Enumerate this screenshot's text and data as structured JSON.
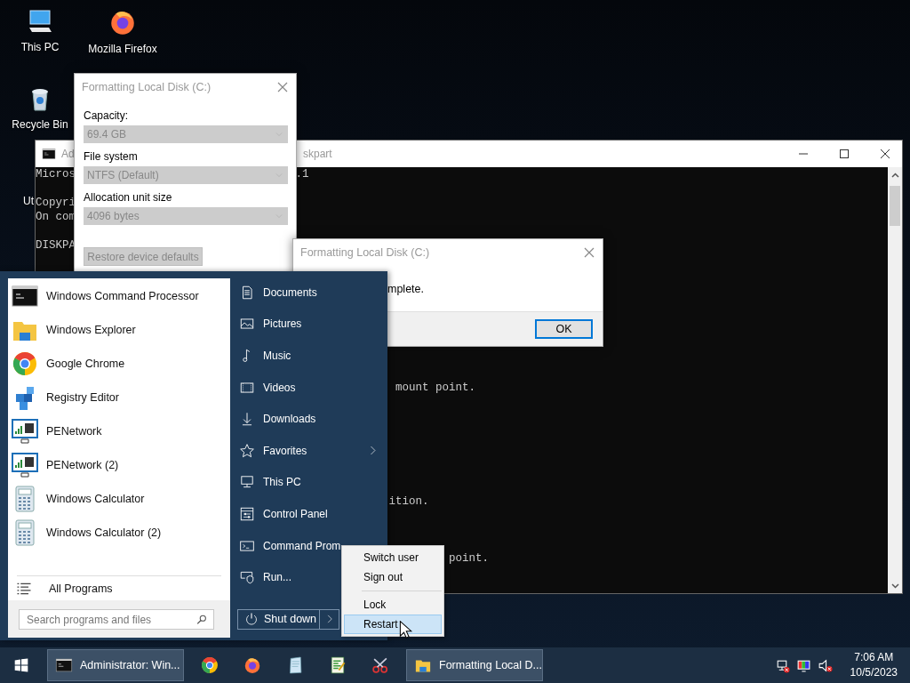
{
  "desktop_icons": [
    {
      "label": "This PC",
      "kind": "computer"
    },
    {
      "label": "Mozilla Firefox",
      "kind": "firefox"
    },
    {
      "label": "Recycle Bin",
      "kind": "recycle"
    },
    {
      "label": "Ut",
      "kind": "cut-off"
    }
  ],
  "cmd_window": {
    "title_parts": [
      "Ad",
      "skpart"
    ],
    "console_lines": [
      "Micros",
      ".1",
      "Copyri",
      "On com",
      "DISKPA",
      "mount point.",
      "ition.",
      "point."
    ]
  },
  "format_dialog": {
    "title": "Formatting Local Disk (C:)",
    "fields": [
      {
        "label": "Capacity:",
        "value": "69.4 GB",
        "disabled": true
      },
      {
        "label": "File system",
        "value": "NTFS (Default)",
        "disabled": true
      },
      {
        "label": "Allocation unit size",
        "value": "4096 bytes",
        "disabled": true
      }
    ],
    "buttons": [
      {
        "label": "Restore device defaults",
        "disabled": true
      }
    ]
  },
  "message_dialog": {
    "title": "Formatting Local Disk (C:)",
    "message": "mplete.",
    "buttons": [
      {
        "label": "OK",
        "focused": true
      }
    ]
  },
  "start_menu": {
    "programs": [
      {
        "name": "Windows Command Processor",
        "kind": "cmd"
      },
      {
        "name": "Windows Explorer",
        "kind": "folder"
      },
      {
        "name": "Google Chrome",
        "kind": "chrome"
      },
      {
        "name": "Registry Editor",
        "kind": "registry"
      },
      {
        "name": "PENetwork",
        "kind": "network"
      },
      {
        "name": "PENetwork (2)",
        "kind": "network"
      },
      {
        "name": "Windows Calculator",
        "kind": "calculator"
      },
      {
        "name": "Windows Calculator (2)",
        "kind": "calculator"
      }
    ],
    "all_programs": "All Programs",
    "search": {
      "placeholder": "Search programs and files"
    },
    "places": [
      {
        "label": "Documents",
        "kind": "document",
        "submenu": false
      },
      {
        "label": "Pictures",
        "kind": "picture",
        "submenu": false
      },
      {
        "label": "Music",
        "kind": "music",
        "submenu": false
      },
      {
        "label": "Videos",
        "kind": "film",
        "submenu": false
      },
      {
        "label": "Downloads",
        "kind": "download",
        "submenu": false
      },
      {
        "label": "Favorites",
        "kind": "star",
        "submenu": true
      },
      {
        "label": "This PC",
        "kind": "pc",
        "submenu": false
      },
      {
        "label": "Control Panel",
        "kind": "control",
        "submenu": false
      },
      {
        "label": "Command Prom",
        "kind": "terminal",
        "submenu": false
      },
      {
        "label": "Run...",
        "kind": "run",
        "submenu": false
      }
    ],
    "shutdown_button": "Shut down"
  },
  "power_menu": {
    "items": [
      {
        "label": "Switch user",
        "selected": false,
        "separator_before": false
      },
      {
        "label": "Sign out",
        "selected": false,
        "separator_before": false
      },
      {
        "label": "Lock",
        "selected": false,
        "separator_before": true
      },
      {
        "label": "Restart",
        "selected": true,
        "separator_before": false
      }
    ]
  },
  "taskbar": {
    "tasks": [
      {
        "kind": "cmd",
        "open_window": true,
        "label": "Administrator: Win..."
      },
      {
        "kind": "chrome",
        "open_window": false
      },
      {
        "kind": "firefox",
        "open_window": false
      },
      {
        "kind": "notepad",
        "open_window": false
      },
      {
        "kind": "editor",
        "open_window": false
      },
      {
        "kind": "scissors",
        "open_window": false
      },
      {
        "kind": "folder",
        "open_window": true,
        "label": "Formatting Local D..."
      }
    ],
    "clock": {
      "time": "7:06 AM",
      "date": "10/5/2023"
    }
  }
}
